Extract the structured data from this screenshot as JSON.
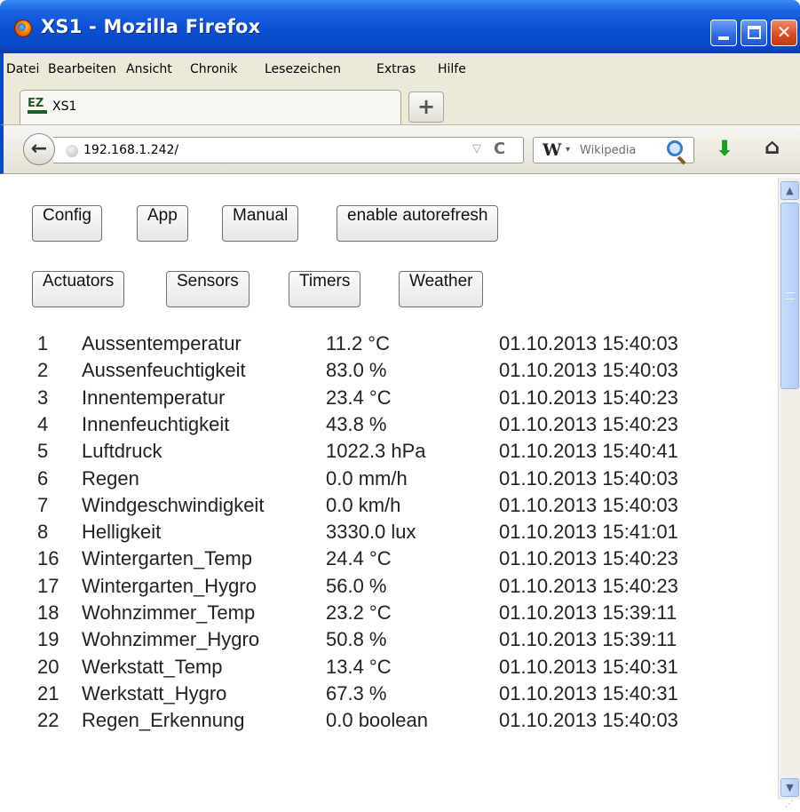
{
  "window": {
    "title": "XS1 - Mozilla Firefox",
    "minimize_glyph": "_",
    "close_glyph": "✕"
  },
  "menubar": [
    {
      "label": "Datei"
    },
    {
      "label": "Bearbeiten"
    },
    {
      "label": "Ansicht"
    },
    {
      "label": "Chronik"
    },
    {
      "label": "Lesezeichen"
    },
    {
      "label": "Extras"
    },
    {
      "label": "Hilfe"
    }
  ],
  "tab": {
    "logo_text": "EZ",
    "title": "XS1",
    "new_tab_glyph": "+"
  },
  "navbar": {
    "back_glyph": "←",
    "url": "192.168.1.242/",
    "url_dropdown_glyph": "▽",
    "reload_glyph": "C",
    "search_engine_glyph": "W",
    "search_engine_caret": "▾",
    "search_placeholder": "Wikipedia",
    "download_glyph": "⬇",
    "home_glyph": "⌂"
  },
  "buttons_row1": [
    {
      "label": "Config"
    },
    {
      "label": "App"
    },
    {
      "label": "Manual"
    },
    {
      "label": "enable autorefresh"
    }
  ],
  "buttons_row2": [
    {
      "label": "Actuators"
    },
    {
      "label": "Sensors"
    },
    {
      "label": "Timers"
    },
    {
      "label": "Weather"
    }
  ],
  "sensors": [
    {
      "id": "1",
      "name": "Aussentemperatur",
      "value": "11.2 °C",
      "time": "01.10.2013 15:40:03"
    },
    {
      "id": "2",
      "name": "Aussenfeuchtigkeit",
      "value": "83.0 %",
      "time": "01.10.2013 15:40:03"
    },
    {
      "id": "3",
      "name": "Innentemperatur",
      "value": "23.4 °C",
      "time": "01.10.2013 15:40:23"
    },
    {
      "id": "4",
      "name": "Innenfeuchtigkeit",
      "value": "43.8 %",
      "time": "01.10.2013 15:40:23"
    },
    {
      "id": "5",
      "name": "Luftdruck",
      "value": "1022.3 hPa",
      "time": "01.10.2013 15:40:41"
    },
    {
      "id": "6",
      "name": "Regen",
      "value": "0.0 mm/h",
      "time": "01.10.2013 15:40:03"
    },
    {
      "id": "7",
      "name": "Windgeschwindigkeit",
      "value": "0.0 km/h",
      "time": "01.10.2013 15:40:03"
    },
    {
      "id": "8",
      "name": "Helligkeit",
      "value": "3330.0 lux",
      "time": "01.10.2013 15:41:01"
    },
    {
      "id": "16",
      "name": "Wintergarten_Temp",
      "value": "24.4 °C",
      "time": "01.10.2013 15:40:23"
    },
    {
      "id": "17",
      "name": "Wintergarten_Hygro",
      "value": "56.0 %",
      "time": "01.10.2013 15:40:23"
    },
    {
      "id": "18",
      "name": "Wohnzimmer_Temp",
      "value": "23.2 °C",
      "time": "01.10.2013 15:39:11"
    },
    {
      "id": "19",
      "name": "Wohnzimmer_Hygro",
      "value": "50.8 %",
      "time": "01.10.2013 15:39:11"
    },
    {
      "id": "20",
      "name": "Werkstatt_Temp",
      "value": "13.4 °C",
      "time": "01.10.2013 15:40:31"
    },
    {
      "id": "21",
      "name": "Werkstatt_Hygro",
      "value": "67.3 %",
      "time": "01.10.2013 15:40:31"
    },
    {
      "id": "22",
      "name": "Regen_Erkennung",
      "value": "0.0 boolean",
      "time": "01.10.2013 15:40:03"
    }
  ],
  "scrollbar": {
    "up_glyph": "▲",
    "down_glyph": "▼",
    "resize_glyph": "⋰"
  }
}
